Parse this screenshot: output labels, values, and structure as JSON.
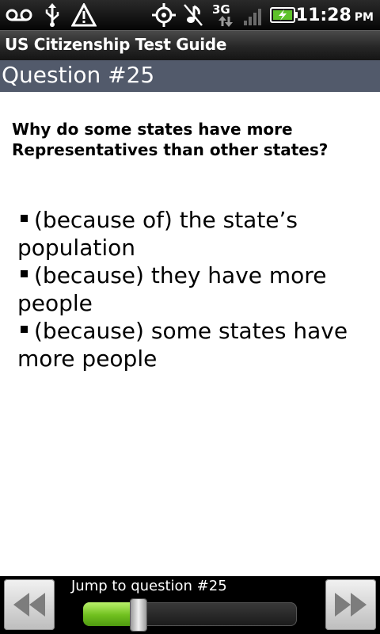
{
  "status_bar": {
    "time": "11:28",
    "ampm": "PM",
    "network": "3G",
    "icons": [
      "voicemail-icon",
      "usb-icon",
      "warning-icon",
      "gps-icon",
      "muted-icon",
      "signal-icon",
      "battery-charging-icon"
    ]
  },
  "app": {
    "title": "US Citizenship Test Guide"
  },
  "question": {
    "header": "Question #25",
    "text": "Why do some states have more Representatives than other states?",
    "answers": [
      "(because of) the state’s population",
      "(because) they have more people",
      "(because) some states have more people"
    ]
  },
  "navigation": {
    "jump_label": "Jump to question #25",
    "prev_icon": "rewind-icon",
    "next_icon": "fast-forward-icon",
    "progress": 0.26
  },
  "colors": {
    "header_bg": "#525a6b",
    "slider_green": "#6fbf1e"
  }
}
